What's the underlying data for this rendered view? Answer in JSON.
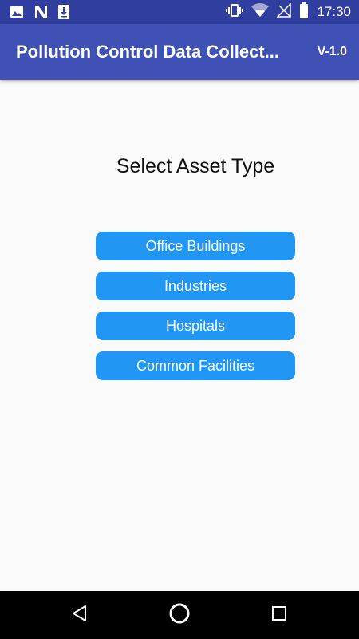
{
  "status_bar": {
    "time": "17:30",
    "left_icons": [
      "image-icon",
      "n-notification-icon",
      "download-icon"
    ],
    "right_icons": [
      "vibrate-icon",
      "wifi-icon",
      "signal-off-icon",
      "battery-icon"
    ]
  },
  "app_bar": {
    "title": "Pollution Control Data Collect...",
    "version": "V-1.0",
    "color": "#3f51b5"
  },
  "main": {
    "heading": "Select Asset Type",
    "asset_types": [
      {
        "label": "Office Buildings"
      },
      {
        "label": "Industries"
      },
      {
        "label": "Hospitals"
      },
      {
        "label": "Common Facilities"
      }
    ],
    "button_color": "#2196f3"
  },
  "nav_bar": {
    "buttons": [
      "back-icon",
      "home-icon",
      "recents-icon"
    ]
  }
}
